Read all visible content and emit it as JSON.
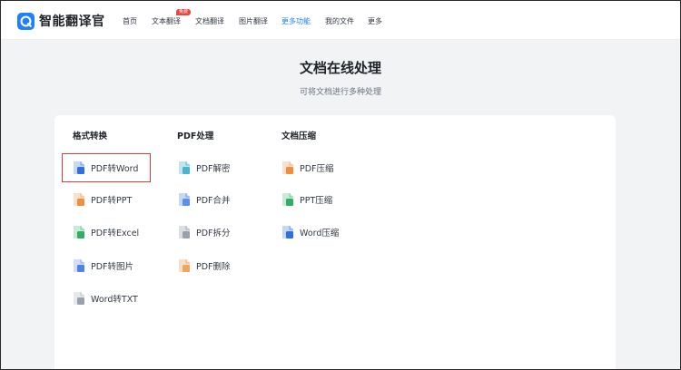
{
  "header": {
    "logo_text": "智能翻译官",
    "nav": [
      {
        "label": "首页"
      },
      {
        "label": "文本翻译",
        "badge": "免费"
      },
      {
        "label": "文档翻译"
      },
      {
        "label": "图片翻译"
      },
      {
        "label": "更多功能",
        "active": true
      },
      {
        "label": "我的文件"
      },
      {
        "label": "更多"
      }
    ]
  },
  "main": {
    "title": "文档在线处理",
    "subtitle": "可将文档进行多种处理"
  },
  "tool_columns": [
    {
      "title": "格式转换",
      "items": [
        {
          "label": "PDF转Word",
          "icon": "pdf-to-word-icon",
          "color": "#5b8ff0",
          "badge_color": "#2f6fe4",
          "badge": "W"
        },
        {
          "label": "PDF转PPT",
          "icon": "pdf-to-ppt-icon",
          "color": "#f3a86a",
          "badge_color": "#ef8e3c",
          "badge": "P"
        },
        {
          "label": "PDF转Excel",
          "icon": "pdf-to-excel-icon",
          "color": "#5fc78c",
          "badge_color": "#2fae66",
          "badge": "X"
        },
        {
          "label": "PDF转图片",
          "icon": "pdf-to-image-icon",
          "color": "#7ea4f0",
          "badge_color": "#4f82e6",
          "badge": ""
        },
        {
          "label": "Word转TXT",
          "icon": "word-to-txt-icon",
          "color": "#b6bcc6",
          "badge_color": "#9aa1ad",
          "badge": "T"
        }
      ]
    },
    {
      "title": "PDF处理",
      "items": [
        {
          "label": "PDF解密",
          "icon": "pdf-decrypt-icon",
          "color": "#48b6cf",
          "badge_color": "#48b6cf",
          "badge": ""
        },
        {
          "label": "PDF合并",
          "icon": "pdf-merge-icon",
          "color": "#5b8ff0",
          "badge_color": "#5b8ff0",
          "badge": ""
        },
        {
          "label": "PDF拆分",
          "icon": "pdf-split-icon",
          "color": "#9aa1ad",
          "badge_color": "#9aa1ad",
          "badge": ""
        },
        {
          "label": "PDF删除",
          "icon": "pdf-delete-icon",
          "color": "#f0a460",
          "badge_color": "#f0a460",
          "badge": ""
        }
      ]
    },
    {
      "title": "文档压缩",
      "items": [
        {
          "label": "PDF压缩",
          "icon": "pdf-compress-icon",
          "color": "#f3a86a",
          "badge_color": "#ef8e3c",
          "badge": ""
        },
        {
          "label": "PPT压缩",
          "icon": "ppt-compress-icon",
          "color": "#5fc78c",
          "badge_color": "#2fae66",
          "badge": ""
        },
        {
          "label": "Word压缩",
          "icon": "word-compress-icon",
          "color": "#5b8ff0",
          "badge_color": "#2f6fe4",
          "badge": ""
        }
      ]
    }
  ],
  "colors": {
    "accent": "#1e80ff",
    "badge": "#e8473d",
    "highlight": "#e03a3a",
    "page_bg": "#f2f3f5"
  }
}
